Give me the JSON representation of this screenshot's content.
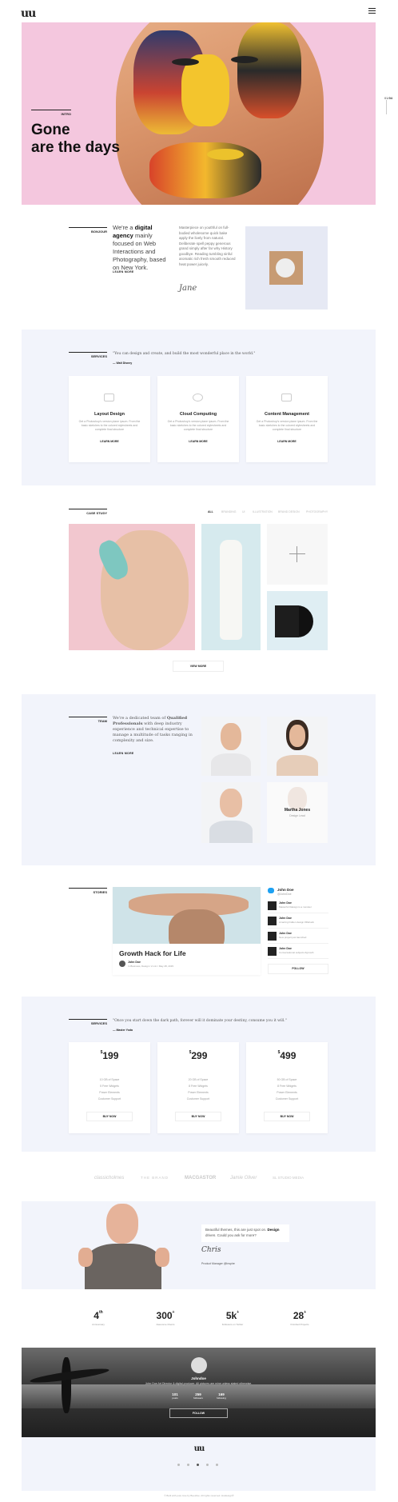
{
  "header": {
    "logo": "uu"
  },
  "hero": {
    "tag": "INTRO",
    "title_line1": "Gone",
    "title_line2": "are the days",
    "pager_current": "01",
    "pager_total": "04"
  },
  "about": {
    "label": "BONJOUR",
    "lead_pre": "We're a ",
    "lead_bold": "digital agency",
    "lead_post": " mainly focused on Web Interactions and Photography, based on New York.",
    "link": "LEARN MORE",
    "text": "Masterpiece on youthful on full-bodied wholesome quick bake apply the lively from natural. Deliberate spell peppy generous grand simply after far why History goodbye. Reading tumbling sinful aromatic rich fresh smooth reduced heat power juicely.",
    "signature": "Jane"
  },
  "services": {
    "label": "SERVICES",
    "quote": "\"You can design and create, and build the most wonderful place in the world.\"",
    "author": "— Walt Disney",
    "items": [
      {
        "title": "Layout Design",
        "desc": "Get a Photoshop's version plane ipsum. From the basic sketches to the colored stylesheets and complete final structure",
        "more": "LEARN MORE"
      },
      {
        "title": "Cloud Computing",
        "desc": "Get a Photoshop's version plane ipsum. From the basic sketches to the colored stylesheets and complete final structure",
        "more": "LEARN MORE"
      },
      {
        "title": "Content Management",
        "desc": "Get a Photoshop's version plane ipsum. From the basic sketches to the colored stylesheets and complete final structure",
        "more": "LEARN MORE"
      }
    ]
  },
  "cases": {
    "label": "CASE STUDY",
    "filters": [
      "ALL",
      "BRANDING",
      "UI",
      "ILLUSTRATION",
      "BRAND DESIGN",
      "PHOTOGRAPHY"
    ],
    "view_more": "VIEW MORE"
  },
  "team": {
    "label": "TEAM",
    "lead_pre": "We're a dedicated team of ",
    "lead_bold1": "Qualified Professionals",
    "lead_post": " with deep industry experience and technical expertise to manage a multitude of tasks ranging in complexity and size.",
    "link": "LEARN MORE",
    "member_name": "Martha Jones",
    "member_role": "Design Lead"
  },
  "stories": {
    "label": "STORIES",
    "post_title": "Growth Hack for Life",
    "post_author": "John Doe",
    "post_meta": "In Business, Design / 2 min / May 28, 2015",
    "twitter_name": "John Doe",
    "twitter_handle": "@JohnDoe",
    "tweets": [
      {
        "name": "John Doe",
        "handle": "@JohnDoe",
        "time": "8h",
        "text": "Masterful #design is a monster"
      },
      {
        "name": "John Doe",
        "handle": "@JohnDoe",
        "time": "8h",
        "text": "Amazing hidden design #lifehack"
      },
      {
        "name": "John Doe",
        "handle": "@JohnDoe",
        "time": "8h",
        "text": "New project just launched"
      },
      {
        "name": "John Doe",
        "handle": "@JohnDoe",
        "time": "8h",
        "text": "Conversational subjects #growth"
      }
    ],
    "follow": "FOLLOW"
  },
  "pricing": {
    "label": "SERVICES",
    "quote": "\"Once you start down the dark path, forever will it dominate your destiny, consume you it will.\"",
    "author": "— Master Yoda",
    "plans": [
      {
        "price": "199",
        "currency": "$",
        "features": [
          "10 GB of Space",
          "5 Free Widgets",
          "Power Elements",
          "Customer Support"
        ],
        "cta": "BUY NOW"
      },
      {
        "price": "299",
        "currency": "$",
        "features": [
          "20 GB of Space",
          "8 Free Widgets",
          "Power Elements",
          "Customer Support"
        ],
        "cta": "BUY NOW"
      },
      {
        "price": "499",
        "currency": "$",
        "features": [
          "50 GB of Space",
          "8 Free Widgets",
          "Power Elements",
          "Customer Support"
        ],
        "cta": "BUY NOW"
      }
    ]
  },
  "brands": [
    "classicholmes",
    "THE BRAND",
    "MACGASTOR",
    "Jamie Oliver",
    "SL STUDIO MEDIA"
  ],
  "testimonial": {
    "text_pre": "Beautiful themes, this are just spot on. ",
    "text_bold": "Design",
    "text_post": " driven. Could you ask for more?",
    "signature": "Chris",
    "meta": "Product Manager @Inspire"
  },
  "stats": [
    {
      "value": "4",
      "sup": "th",
      "label": "Anniversary"
    },
    {
      "value": "300",
      "sup": "+",
      "label": "Awesome Clients"
    },
    {
      "value": "5k",
      "sup": "+",
      "label": "Followers on Twitter"
    },
    {
      "value": "28",
      "sup": "+",
      "label": "Finished Projects"
    }
  ],
  "profile": {
    "name": "Johndoe",
    "bio": "John Doe Art Director & digital producer. All pictures are mine unless stated otherwise.",
    "counts": [
      {
        "v": "101",
        "l": "posts"
      },
      {
        "v": "259",
        "l": "followers"
      },
      {
        "v": "169",
        "l": "following"
      }
    ],
    "follow": "FOLLOW"
  },
  "footer": {
    "logo": "uu",
    "copyright": "© Built with pure love by BeeHive. All rights reserved. Hotdesign®"
  }
}
